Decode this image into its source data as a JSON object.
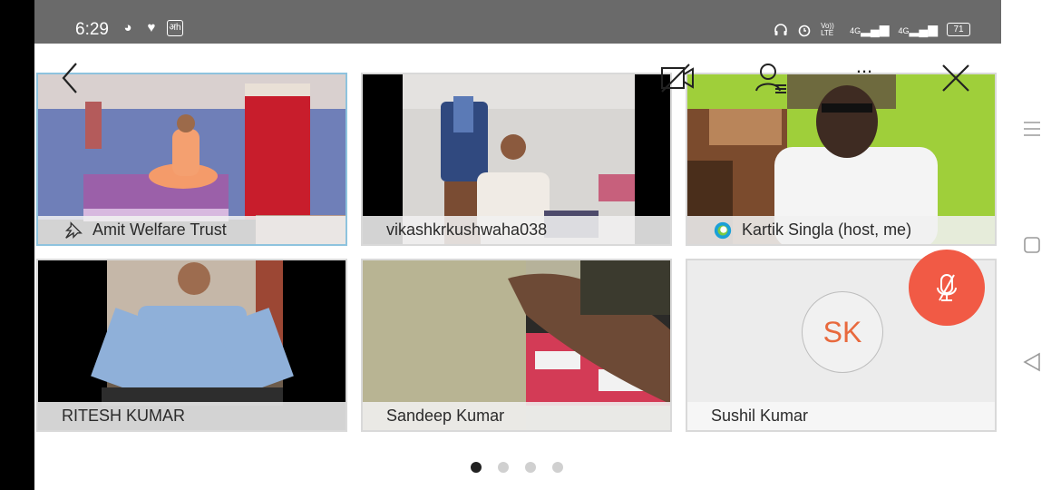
{
  "status_bar": {
    "time": "6:29",
    "volte": "Vo)) LTE",
    "network1": "4G",
    "network2": "4G",
    "battery": "71"
  },
  "controls": {
    "back": "back-arrow-icon",
    "video_off": "video-off-icon",
    "participants": "participants-icon",
    "more": "...",
    "close": "close-icon"
  },
  "tiles": [
    {
      "name": "Amit Welfare Trust",
      "pinned": true
    },
    {
      "name": "vikashkrkushwaha038"
    },
    {
      "name": "Kartik Singla (host, me)"
    },
    {
      "name": "RITESH KUMAR"
    },
    {
      "name": "Sandeep Kumar"
    },
    {
      "name": "Sushil Kumar",
      "initials": "SK"
    }
  ],
  "pager": {
    "pages": 4,
    "current": 1
  },
  "colors": {
    "accent": "#f15a45",
    "initials": "#e8693d",
    "active_border": "#8ec3de"
  }
}
